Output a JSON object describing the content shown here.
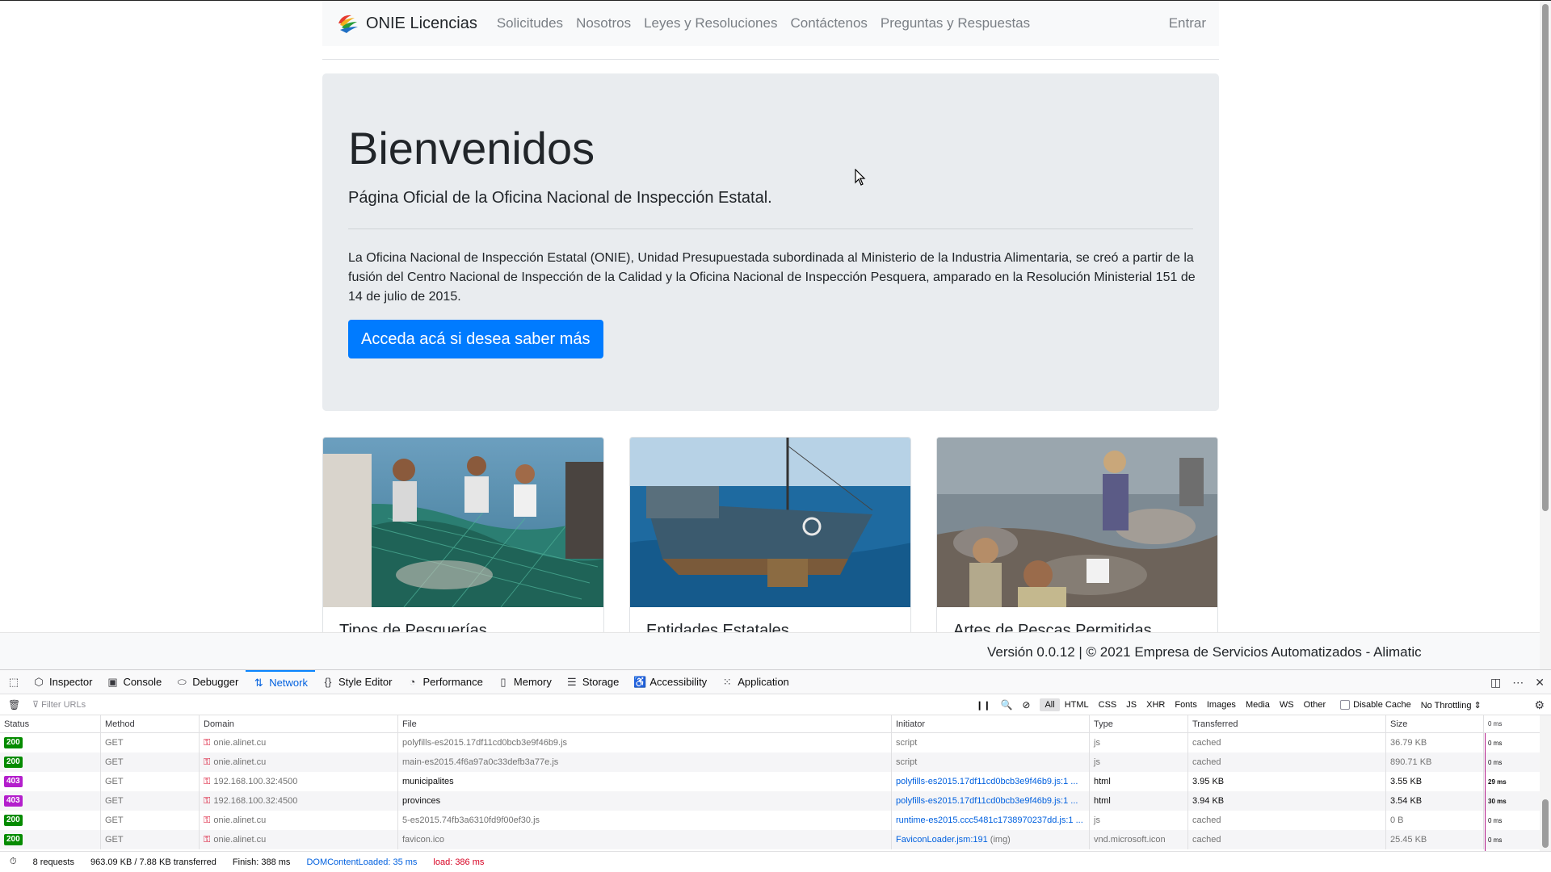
{
  "nav": {
    "brand": "ONIE Licencias",
    "links": [
      "Solicitudes",
      "Nosotros",
      "Leyes y Resoluciones",
      "Contáctenos",
      "Preguntas y Respuestas"
    ],
    "login": "Entrar"
  },
  "hero": {
    "title": "Bienvenidos",
    "lead": "Página Oficial de la Oficina Nacional de Inspección Estatal.",
    "description": "La Oficina Nacional de Inspección Estatal (ONIE), Unidad Presupuestada subordinada al Ministerio de la Industria Alimentaria, se creó a partir de la fusión del Centro Nacional de Inspección de la Calidad y la Oficina Nacional de Inspección Pesquera, amparado en la Resolución Ministerial 151 de 14 de julio de 2015.",
    "button": "Acceda acá si desea saber más"
  },
  "cards": [
    {
      "title": "Tipos de Pesquerías"
    },
    {
      "title": "Entidades Estatales"
    },
    {
      "title": "Artes de Pescas Permitidas"
    }
  ],
  "footer": {
    "text": "Versión 0.0.12 | © 2021 Empresa de Servicios Automatizados - Alimatic"
  },
  "devtools": {
    "tabs": [
      "Inspector",
      "Console",
      "Debugger",
      "Network",
      "Style Editor",
      "Performance",
      "Memory",
      "Storage",
      "Accessibility",
      "Application"
    ],
    "active_tab": "Network",
    "filter_placeholder": "Filter URLs",
    "type_filters": [
      "All",
      "HTML",
      "CSS",
      "JS",
      "XHR",
      "Fonts",
      "Images",
      "Media",
      "WS",
      "Other"
    ],
    "disable_cache": "Disable Cache",
    "throttling": "No Throttling",
    "columns": {
      "status": "Status",
      "method": "Method",
      "domain": "Domain",
      "file": "File",
      "initiator": "Initiator",
      "type": "Type",
      "transferred": "Transferred",
      "size": "Size",
      "waterfall": "0 ms"
    },
    "requests": [
      {
        "status": "200",
        "method": "GET",
        "domain": "onie.alinet.cu",
        "file": "polyfills-es2015.17df11cd0bcb3e9f46b9.js",
        "initiator": "script",
        "type": "js",
        "transferred": "cached",
        "size": "36.79 KB",
        "time": "0 ms"
      },
      {
        "status": "200",
        "method": "GET",
        "domain": "onie.alinet.cu",
        "file": "main-es2015.4f6a97a0c33defb3a77e.js",
        "initiator": "script",
        "type": "js",
        "transferred": "cached",
        "size": "890.71 KB",
        "time": "0 ms"
      },
      {
        "status": "403",
        "method": "GET",
        "domain": "192.168.100.32:4500",
        "file": "municipalites",
        "initiator": "polyfills-es2015.17df11cd0bcb3e9f46b9.js:1 ...",
        "type": "html",
        "transferred": "3.95 KB",
        "size": "3.55 KB",
        "time": "29 ms"
      },
      {
        "status": "403",
        "method": "GET",
        "domain": "192.168.100.32:4500",
        "file": "provinces",
        "initiator": "polyfills-es2015.17df11cd0bcb3e9f46b9.js:1 ...",
        "type": "html",
        "transferred": "3.94 KB",
        "size": "3.54 KB",
        "time": "30 ms"
      },
      {
        "status": "200",
        "method": "GET",
        "domain": "onie.alinet.cu",
        "file": "5-es2015.74fb3a6310fd9f00ef30.js",
        "initiator": "runtime-es2015.ccc5481c1738970237dd.js:1 ...",
        "type": "js",
        "transferred": "cached",
        "size": "0 B",
        "time": "0 ms"
      },
      {
        "status": "200",
        "method": "GET",
        "domain": "onie.alinet.cu",
        "file": "favicon.ico",
        "initiator": "FaviconLoader.jsm:191",
        "initiator_extra": "(img)",
        "type": "vnd.microsoft.icon",
        "transferred": "cached",
        "size": "25.45 KB",
        "time": "0 ms"
      }
    ],
    "status_bar": {
      "requests": "8 requests",
      "transferred": "963.09 KB / 7.88 KB transferred",
      "finish": "Finish: 388 ms",
      "dom_loaded": "DOMContentLoaded: 35 ms",
      "load": "load: 386 ms"
    }
  },
  "colors": {
    "primary": "#007bff",
    "ok_badge": "#058b00",
    "forbidden_badge": "#b31ecc",
    "devtools_accent": "#0a84ff"
  }
}
